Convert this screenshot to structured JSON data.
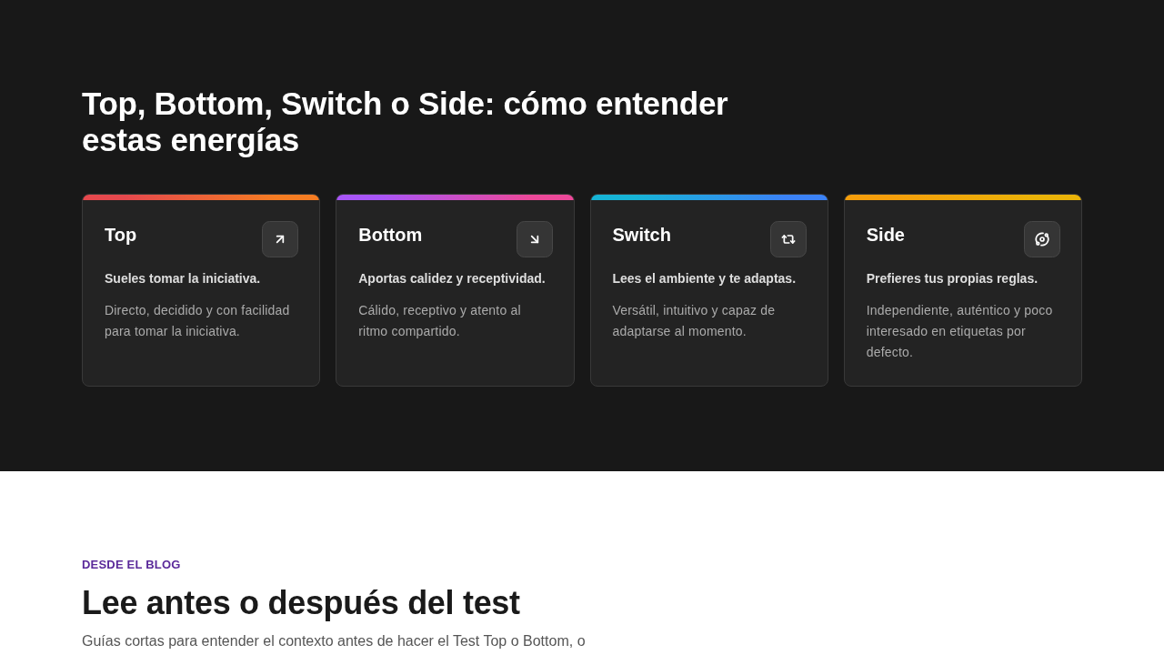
{
  "energies_section": {
    "heading": "Top, Bottom, Switch o Side: cómo entender estas energías",
    "cards": [
      {
        "title": "Top",
        "gradient": [
          {
            "color": "#e5484d"
          },
          {
            "color": "#f57c22"
          }
        ],
        "tagline": "Sueles tomar la iniciativa.",
        "description": "Directo, decidido y con facilidad para tomar la iniciativa."
      },
      {
        "title": "Bottom",
        "gradient": [
          {
            "color": "#a855f7"
          },
          {
            "color": "#ec4899"
          }
        ],
        "tagline": "Aportas calidez y receptividad.",
        "description": "Cálido, receptivo y atento al ritmo compartido."
      },
      {
        "title": "Switch",
        "gradient": [
          {
            "color": "#16b4d6"
          },
          {
            "color": "#3b82f6"
          }
        ],
        "tagline": "Lees el ambiente y te adaptas.",
        "description": "Versátil, intuitivo y capaz de adaptarse al momento."
      },
      {
        "title": "Side",
        "gradient": [
          {
            "color": "#f59e0b"
          },
          {
            "color": "#eab308"
          }
        ],
        "tagline": "Prefieres tus propias reglas.",
        "description": "Independiente, auténtico y poco interesado en etiquetas por defecto."
      }
    ]
  },
  "blog_section": {
    "eyebrow": "DESDE EL BLOG",
    "heading": "Lee antes o después del test",
    "intro": "Guías cortas para entender el contexto antes de hacer el Test Top o Bottom, o"
  }
}
